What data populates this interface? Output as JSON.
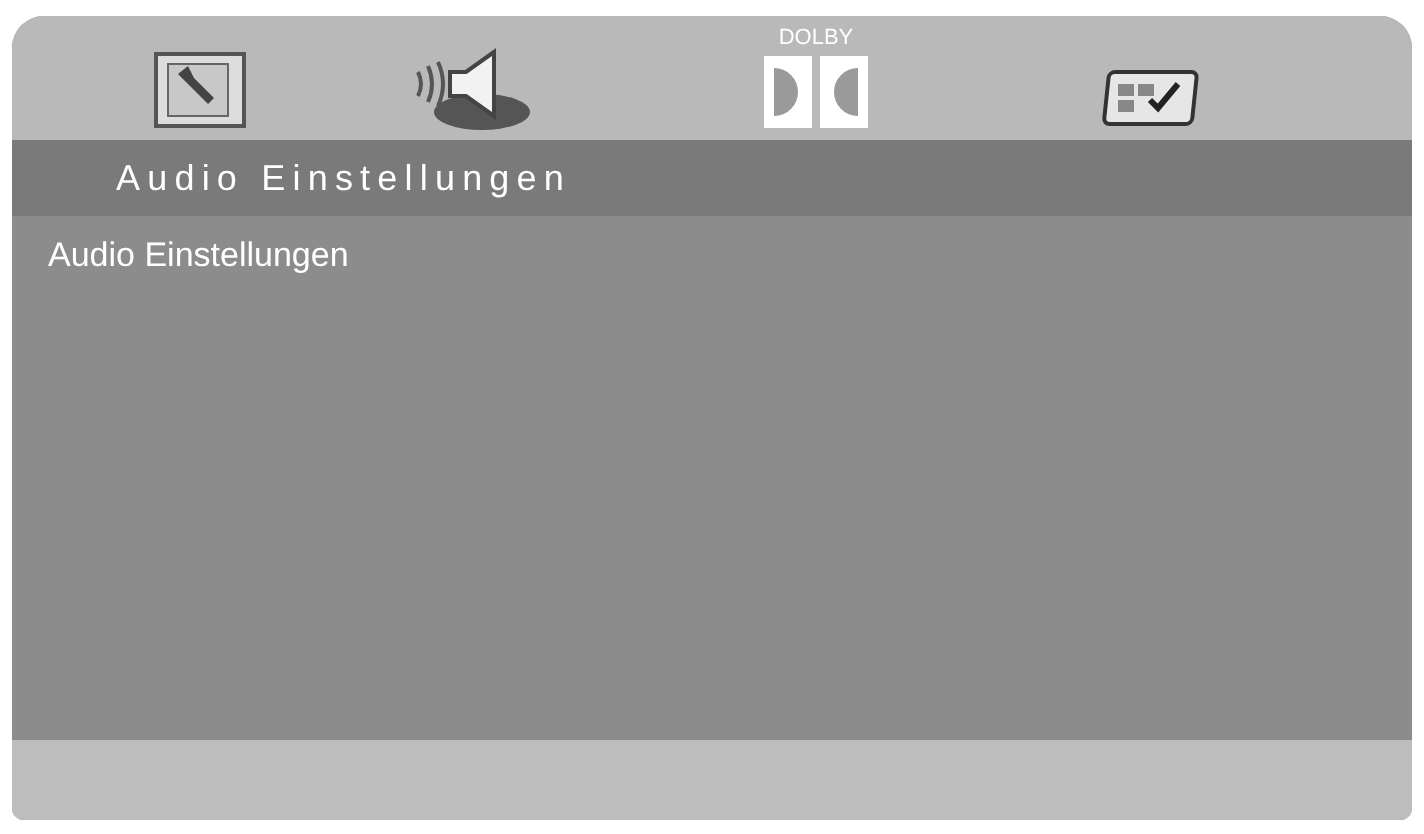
{
  "tabs": [
    {
      "kind": "setup",
      "selected": false
    },
    {
      "kind": "audio",
      "selected": true
    },
    {
      "kind": "dolby",
      "label": "DOLBY",
      "selected": false
    },
    {
      "kind": "preference",
      "selected": false
    }
  ],
  "title_bar": {
    "title": "Audio Einstellungen"
  },
  "content": {
    "items": [
      "Audio Einstellungen"
    ]
  }
}
